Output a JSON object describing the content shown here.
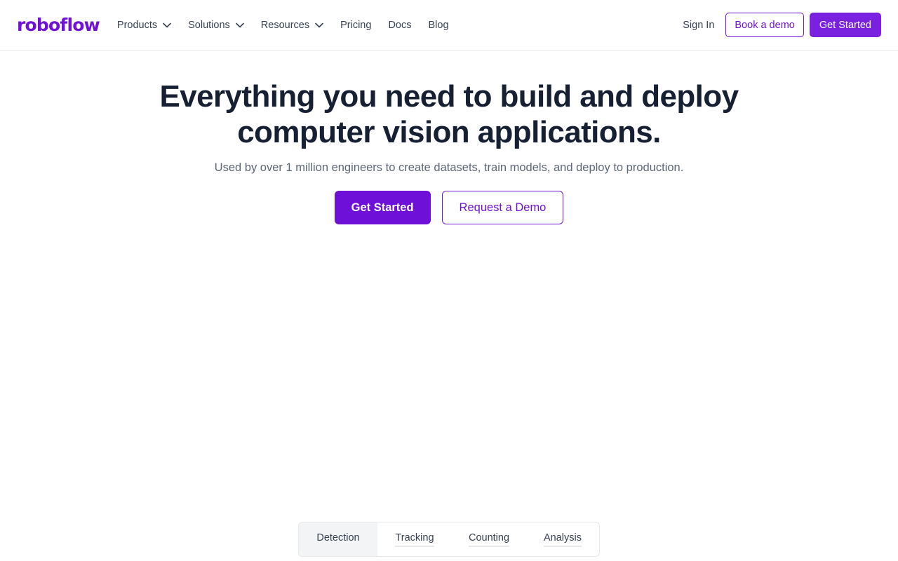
{
  "brand": {
    "logo_text": "roboflow",
    "accent": "#6f12d6"
  },
  "nav": {
    "items": [
      {
        "label": "Products",
        "dropdown": true
      },
      {
        "label": "Solutions",
        "dropdown": true
      },
      {
        "label": "Resources",
        "dropdown": true
      },
      {
        "label": "Pricing",
        "dropdown": false
      },
      {
        "label": "Docs",
        "dropdown": false
      },
      {
        "label": "Blog",
        "dropdown": false
      }
    ],
    "sign_in": "Sign In",
    "book_demo": "Book a demo",
    "get_started": "Get Started"
  },
  "hero": {
    "title_line1": "Everything you need to build and deploy",
    "title_line2": "computer vision applications.",
    "subtitle": "Used by over 1 million engineers to create datasets, train models, and deploy to production.",
    "primary_cta": "Get Started",
    "secondary_cta": "Request a Demo"
  },
  "tabs": {
    "items": [
      "Detection",
      "Tracking",
      "Counting",
      "Analysis"
    ],
    "active": "Detection"
  }
}
